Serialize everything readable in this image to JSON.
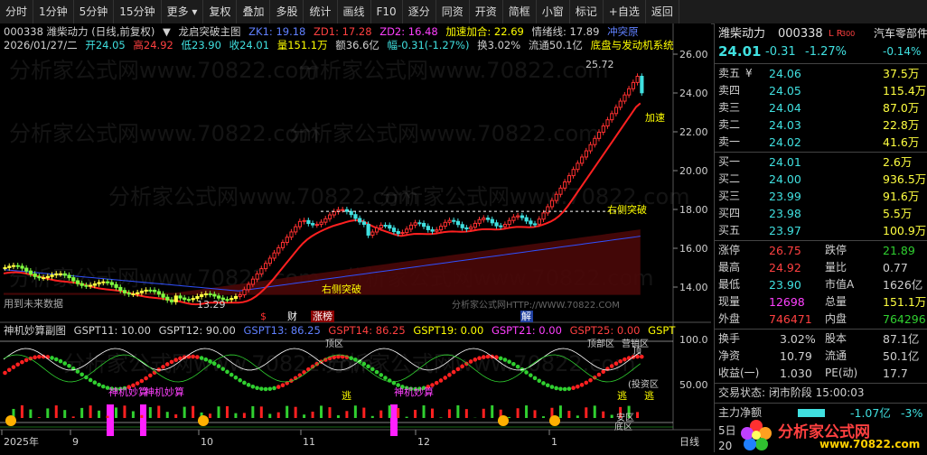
{
  "toolbar": [
    "分时",
    "1分钟",
    "5分钟",
    "15分钟",
    "更多",
    "复权",
    "叠加",
    "多股",
    "统计",
    "画线",
    "F10",
    "逐分",
    "同资",
    "开资",
    "简框",
    "小窗",
    "标记",
    "+自选",
    "返回"
  ],
  "toolbar_more_icon": "triangle-down-icon",
  "info1": {
    "title": "000338 潍柴动力 (日线,前复权)",
    "indicator": "龙启突破主图",
    "zk1": "ZK1: 19.18",
    "zd1": "ZD1: 17.28",
    "zd2": "ZD2: 16.48",
    "accel": "加速加合: 22.69",
    "mood": "情绪线: 17.89",
    "tag": "冲突原"
  },
  "info2": {
    "date": "2026/01/27/二",
    "open": "开24.05",
    "high": "高24.92",
    "low": "低23.90",
    "close": "收24.01",
    "vol": "量151.1万",
    "amount": "额36.6亿",
    "change": "幅-0.31(-1.27%)",
    "turnover": "换3.02%",
    "float": "流通50.1亿",
    "concept": "底盘与发动机系统"
  },
  "sub_info": {
    "name": "神机妙算副图",
    "g11": "GSPT11: 10.00",
    "g12": "GSPT12: 90.00",
    "g13": "GSPT13: 86.25",
    "g14": "GSPT14: 86.25",
    "g19": "GSPT19: 0.00",
    "g21": "GSPT21: 0.00",
    "g25": "GSPT25: 0.00",
    "g_last": "GSPT"
  },
  "chart_labels": {
    "high_mark": "25.72",
    "low_mark": "13.29",
    "right_break_1": "右侧突破",
    "right_break_2": "右侧突破",
    "accel": "加速",
    "future": "用到未来数据",
    "watermark": "分析家公式网HTTP://WWW.70822.COM",
    "marker_s": "$",
    "marker_cai": "财",
    "marker_zhang": "涨榜",
    "marker_jie": "解",
    "sub_tao1": "逃",
    "sub_tao2": "逃",
    "sub_tao3": "逃",
    "sub_shenji1": "神机妙算",
    "sub_shenji2": "神机妙算",
    "sub_shenji3": "神机妙算",
    "sub_touzi": "(投资区",
    "sub_ding": "顶",
    "sub_yingxiao": "营销区",
    "sub_anqu": "安区",
    "sub_dixi": "底区",
    "sub_dingqu": "顶区",
    "sub_dingbu": "顶部区"
  },
  "watermark_text": "分析家公式网www.70822.com",
  "x_axis": [
    "2025年",
    "9",
    "10",
    "11",
    "12",
    "1",
    "日线"
  ],
  "y_axis_main": [
    "26.00",
    "24.00",
    "22.00",
    "20.00",
    "18.00",
    "16.00",
    "14.00"
  ],
  "y_axis_sub": [
    "100.0",
    "50.00"
  ],
  "quote": {
    "name": "潍柴动力",
    "code": "000338",
    "tag": "L R",
    "tag_num": "300",
    "sector": "汽车零部件",
    "price": "24.01",
    "change": "-0.31",
    "pct": "-1.27%",
    "sector_pct": "-0.14%",
    "sells": [
      {
        "label": "卖五",
        "price": "24.06",
        "vol": "37.5万"
      },
      {
        "label": "卖四",
        "price": "24.05",
        "vol": "115.4万"
      },
      {
        "label": "卖三",
        "price": "24.04",
        "vol": "87.0万"
      },
      {
        "label": "卖二",
        "price": "24.03",
        "vol": "22.8万"
      },
      {
        "label": "卖一",
        "price": "24.02",
        "vol": "41.6万"
      }
    ],
    "sell5_mark": "¥",
    "buys": [
      {
        "label": "买一",
        "price": "24.01",
        "vol": "2.6万"
      },
      {
        "label": "买二",
        "price": "24.00",
        "vol": "936.5万"
      },
      {
        "label": "买三",
        "price": "23.99",
        "vol": "91.6万"
      },
      {
        "label": "买四",
        "price": "23.98",
        "vol": "5.5万"
      },
      {
        "label": "买五",
        "price": "23.97",
        "vol": "100.9万"
      }
    ],
    "stats": [
      {
        "l1": "涨停",
        "v1": "26.75",
        "l2": "跌停",
        "v2": "21.89"
      },
      {
        "l1": "最高",
        "v1": "24.92",
        "l2": "量比",
        "v2": "0.77"
      },
      {
        "l1": "最低",
        "v1": "23.90",
        "l2": "市值A",
        "v2": "1626亿"
      },
      {
        "l1": "现量",
        "v1": "12698",
        "l2": "总量",
        "v2": "151.1万"
      },
      {
        "l1": "外盘",
        "v1": "746471",
        "l2": "内盘",
        "v2": "764296"
      }
    ],
    "stats2": [
      {
        "l1": "换手",
        "v1": "3.02%",
        "l2": "股本",
        "v2": "87.1亿"
      },
      {
        "l1": "净资",
        "v1": "10.79",
        "l2": "流通",
        "v2": "50.1亿"
      },
      {
        "l1": "收益(一)",
        "v1": "1.030",
        "l2": "PE(动)",
        "v2": "17.7"
      }
    ],
    "trade_state": "交易状态: 闭市阶段 15:00:03",
    "main_net_label": "主力净额",
    "main_net_value": "-1.07亿",
    "main_net_pct": "-3%",
    "day5": "5日",
    "day20": "20",
    "logo_text": "分析家公式网",
    "logo_url": "www.70822.com"
  }
}
